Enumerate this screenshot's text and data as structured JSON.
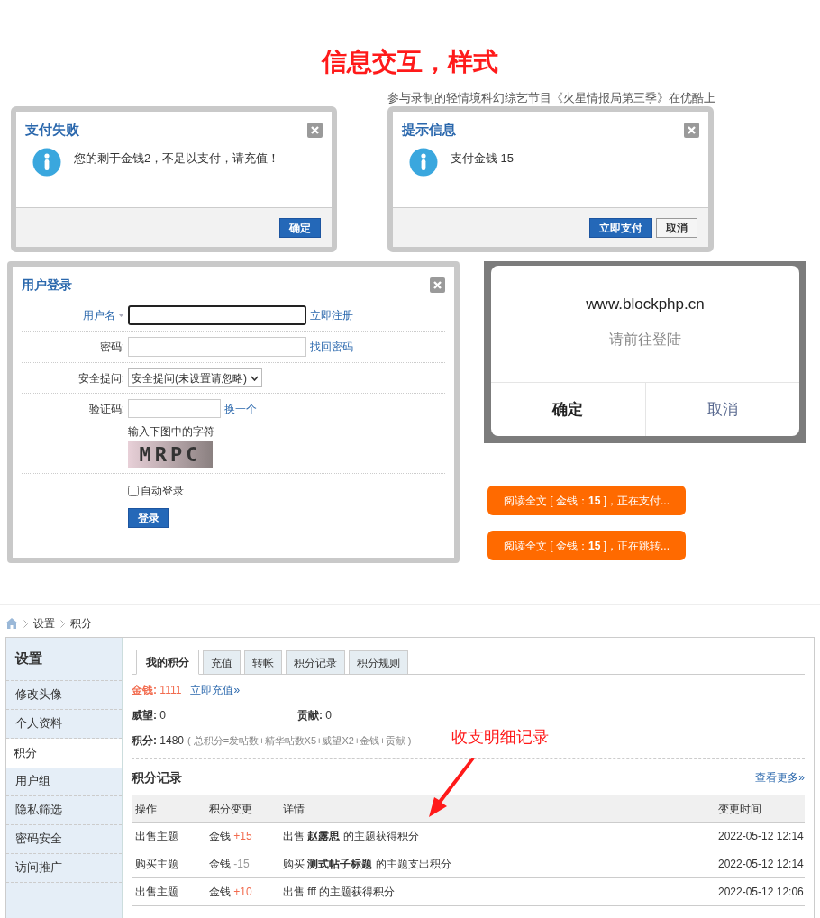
{
  "title": "信息交互，样式",
  "dialogs": [
    {
      "title": "支付失败",
      "message": "您的剩于金钱2，不足以支付，请充值！",
      "buttons": [
        {
          "label": "确定",
          "kind": "primary"
        }
      ]
    },
    {
      "background_text": "参与录制的轻情境科幻综艺节目《火星情报局第三季》在优酷上",
      "title": "提示信息",
      "message": "支付金钱 15",
      "buttons": [
        {
          "label": "立即支付",
          "kind": "primary"
        },
        {
          "label": "取消",
          "kind": "secondary"
        }
      ]
    }
  ],
  "login": {
    "title": "用户登录",
    "fields": [
      {
        "kind": "text",
        "label": "用户名",
        "focused": true,
        "link": "立即注册"
      },
      {
        "kind": "password",
        "label": "密码:",
        "focused": false,
        "link": "找回密码"
      },
      {
        "kind": "select",
        "label": "安全提问:",
        "value": "安全提问(未设置请忽略)"
      },
      {
        "kind": "captcha",
        "label": "验证码:",
        "link": "换一个",
        "hint": "输入下图中的字符",
        "captcha": "MRPC"
      }
    ],
    "remember": {
      "label": "自动登录",
      "checked": false
    },
    "submit": "登录"
  },
  "alert": {
    "site": "www.blockphp.cn",
    "message": "请前往登陆",
    "buttons": [
      {
        "label": "确定",
        "kind": "confirm"
      },
      {
        "label": "取消",
        "kind": "cancel"
      }
    ]
  },
  "status_buttons": [
    "阅读全文 [ 金钱：**15** ]，正在支付...",
    "阅读全文 [ 金钱：**15** ]，正在跳转..."
  ],
  "breadcrumb": [
    "设置",
    "积分"
  ],
  "sidebar": {
    "title": "设置",
    "items": [
      {
        "label": "修改头像",
        "selected": false
      },
      {
        "label": "个人资料",
        "selected": false
      },
      {
        "label": "积分",
        "selected": true
      },
      {
        "label": "用户组",
        "selected": false
      },
      {
        "label": "隐私筛选",
        "selected": false
      },
      {
        "label": "密码安全",
        "selected": false
      },
      {
        "label": "访问推广",
        "selected": false
      }
    ]
  },
  "tabs": [
    {
      "label": "我的积分",
      "selected": true
    },
    {
      "label": "充值",
      "selected": false
    },
    {
      "label": "转帐",
      "selected": false
    },
    {
      "label": "积分记录",
      "selected": false
    },
    {
      "label": "积分规则",
      "selected": false
    }
  ],
  "money": {
    "label": "金钱:",
    "value": "1111",
    "link": "立即充值»"
  },
  "stats": [
    {
      "label": "威望:",
      "value": "0"
    },
    {
      "label": "贡献:",
      "value": "0"
    }
  ],
  "total": {
    "label": "积分:",
    "value": "1480",
    "formula": "( 总积分=发帖数+精华帖数X5+威望X2+金钱+贡献 )"
  },
  "records": {
    "title": "积分记录",
    "more": "查看更多»",
    "columns": [
      "操作",
      "积分变更",
      "详情",
      "变更时间"
    ],
    "rows": [
      {
        "action": "出售主题",
        "currency": "金钱",
        "change": "+15",
        "kind": "gain",
        "detail": "出售 **赵露思** 的主题获得积分",
        "time": "2022-05-12 12:14"
      },
      {
        "action": "购买主题",
        "currency": "金钱",
        "change": "-15",
        "kind": "loss",
        "detail": "购买 **测式帖子标题** 的主题支出积分",
        "time": "2022-05-12 12:14"
      },
      {
        "action": "出售主题",
        "currency": "金钱",
        "change": "+10",
        "kind": "gain",
        "detail": "出售 fff 的主题获得积分",
        "time": "2022-05-12 12:06"
      }
    ]
  },
  "annotation": "收支明细记录"
}
